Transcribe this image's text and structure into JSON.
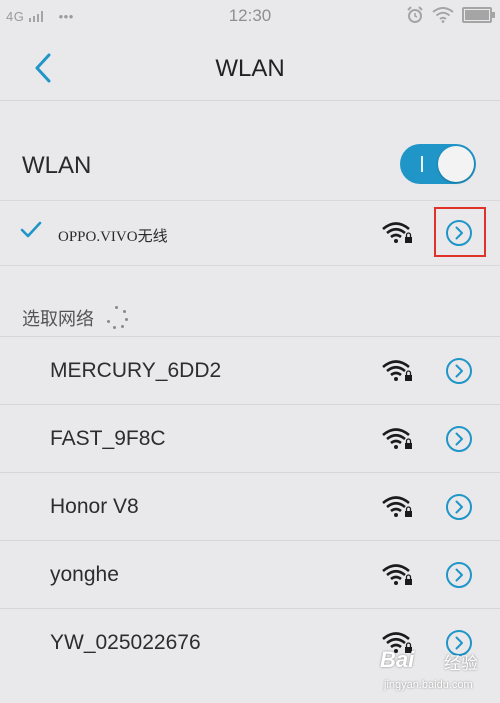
{
  "status_bar": {
    "network": "4G",
    "dots": "•••",
    "time": "12:30"
  },
  "header": {
    "title": "WLAN",
    "back_icon": "chevron-left-icon"
  },
  "wlan": {
    "label": "WLAN",
    "enabled": true
  },
  "connected_network": {
    "name": "OPPO.VIVO无线",
    "connected": true
  },
  "available_networks": {
    "header": "选取网络",
    "items": [
      {
        "name": "MERCURY_6DD2",
        "secured": true
      },
      {
        "name": "FAST_9F8C",
        "secured": true
      },
      {
        "name": "Honor V8",
        "secured": true
      },
      {
        "name": "yonghe",
        "secured": true
      },
      {
        "name": "YW_025022676",
        "secured": true
      }
    ]
  },
  "watermark": {
    "logo": "Bai",
    "brand": "经验",
    "url": "jingyan.baidu.com"
  },
  "colors": {
    "accent": "#1f95c8",
    "highlight": "#e0322b"
  }
}
